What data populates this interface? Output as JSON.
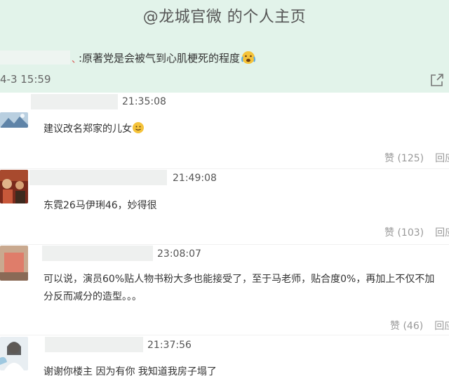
{
  "header": {
    "title": "@龙城官微 的个人主页"
  },
  "post": {
    "text": ":原著党是会被气到心肌梗死的程度",
    "time": "4-3 15:59",
    "separator": "、"
  },
  "comments": [
    {
      "time": "21:35:08",
      "text": "建议改名郑家的儿女",
      "like": "赞 (125)",
      "reply": "回应"
    },
    {
      "time": "21:49:08",
      "text": "东霓26马伊琍46，妙得很",
      "like": "赞 (103)",
      "reply": "回应"
    },
    {
      "time": "23:08:07",
      "text": "可以说，演员60%贴人物书粉大多也能接受了，至于马老师，贴合度0%，再加上不仅不加",
      "text2": "分反而减分的造型。。。",
      "like": "赞 (46)",
      "reply": "回应"
    },
    {
      "time": "21:37:56",
      "text": "谢谢你楼主 因为有你 我知道我房子塌了"
    }
  ],
  "colors": {
    "header_bg": "#e2f3ea",
    "name_bar": "#eef0ef",
    "muted": "#999999"
  },
  "icons": [
    "share-icon",
    "smile-emoji-icon",
    "crying-emoji-icon"
  ]
}
